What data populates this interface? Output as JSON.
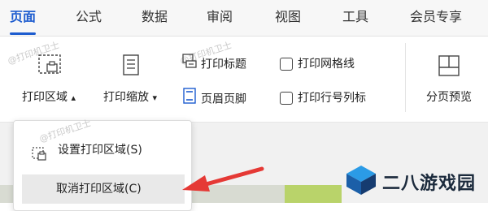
{
  "tabs": [
    "页面",
    "公式",
    "数据",
    "审阅",
    "视图",
    "工具",
    "会员专享"
  ],
  "watermark": "@打印机卫士",
  "ribbon": {
    "print_area": "打印区域",
    "print_area_chevron": "▴",
    "print_scale": "打印缩放",
    "print_scale_chevron": "▾",
    "print_titles": "打印标题",
    "header_footer": "页眉页脚",
    "print_gridlines": "打印网格线",
    "print_row_col_headers": "打印行号列标",
    "page_break_preview": "分页预览"
  },
  "dropdown": {
    "set_print_area": "设置打印区域(S)",
    "cancel_print_area": "取消打印区域(C)"
  },
  "brand": {
    "name": "二八游戏园"
  },
  "colors": {
    "accent": "#1d5ccf",
    "arrow": "#e53935"
  },
  "icons": [
    "print-area-icon",
    "print-scale-icon",
    "print-titles-icon",
    "header-footer-icon",
    "page-break-preview-icon",
    "set-print-area-icon",
    "dialog-launcher-icon",
    "brand-logo-icon"
  ]
}
